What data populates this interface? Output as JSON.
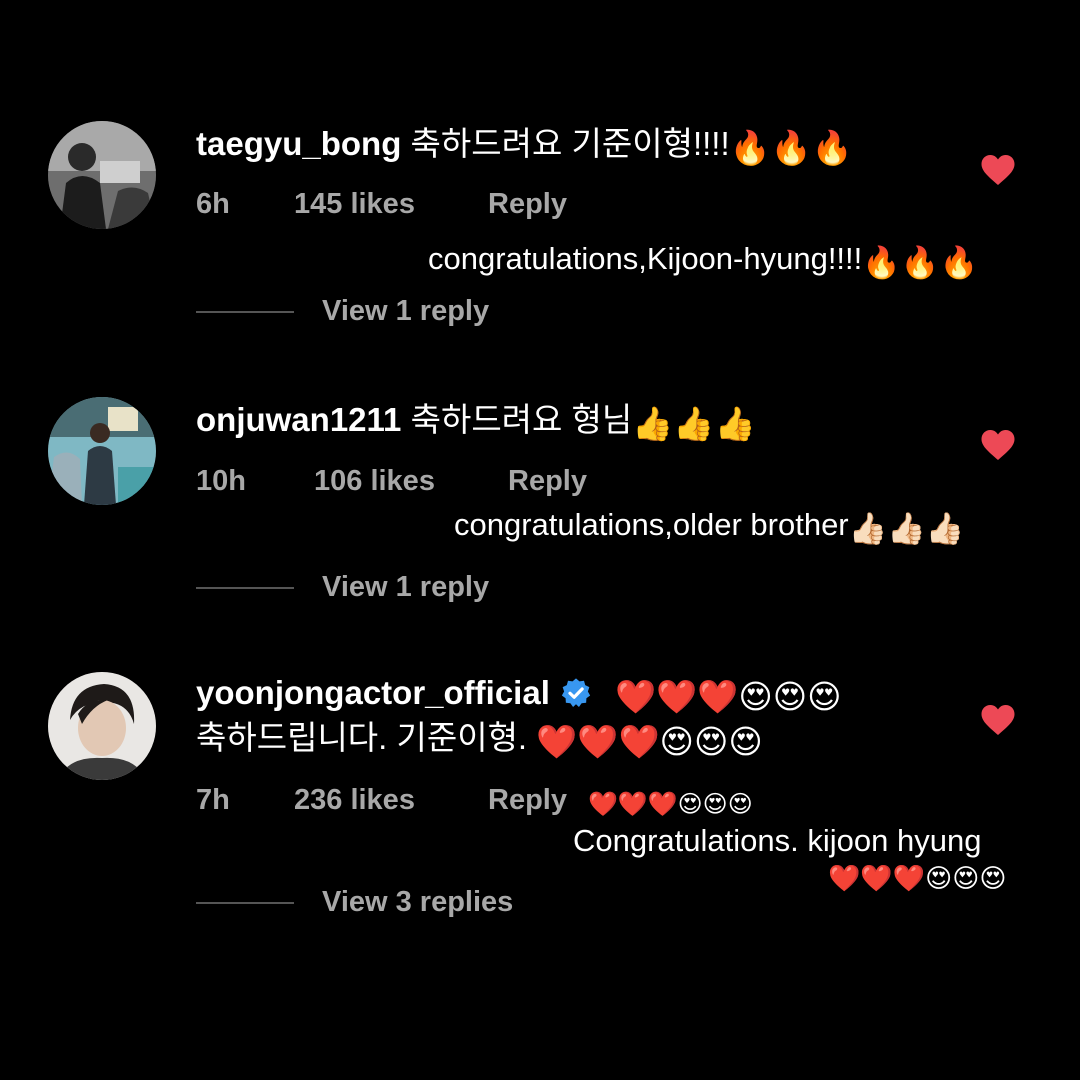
{
  "comments": [
    {
      "username": "taegyu_bong",
      "text": "축하드려요 기준이형!!!!",
      "emoji": "🔥🔥🔥",
      "time": "6h",
      "likes": "145 likes",
      "reply_label": "Reply",
      "view_replies": "View 1 reply",
      "translation": "congratulations,Kijoon-hyung!!!!",
      "translation_emoji": "🔥🔥🔥",
      "avatar_icon": "profile-photo"
    },
    {
      "username": "onjuwan1211",
      "text": "축하드려요 형님",
      "emoji": "👍👍👍",
      "time": "10h",
      "likes": "106 likes",
      "reply_label": "Reply",
      "view_replies": "View 1 reply",
      "translation": "congratulations,older brother",
      "translation_emoji": "👍🏻👍🏻👍🏻",
      "avatar_icon": "profile-photo"
    },
    {
      "username": "yoonjongactor_official",
      "verified": true,
      "text_line1_emoji": "❤️❤️❤️😍😍😍",
      "text_line2": "축하드립니다. 기준이형.",
      "text_line2_emoji": "❤️❤️❤️😍😍😍",
      "time": "7h",
      "likes": "236 likes",
      "reply_label": "Reply",
      "view_replies": "View 3 replies",
      "translation_emoji_top": "❤️❤️❤️😍😍😍",
      "translation": "Congratulations. kijoon hyung",
      "translation_emoji": "❤️❤️❤️😍😍😍",
      "avatar_icon": "profile-photo"
    }
  ],
  "colors": {
    "background": "#000000",
    "heart": "#ed4956",
    "meta_text": "#a8a8a8",
    "verified_badge": "#3897f0"
  }
}
